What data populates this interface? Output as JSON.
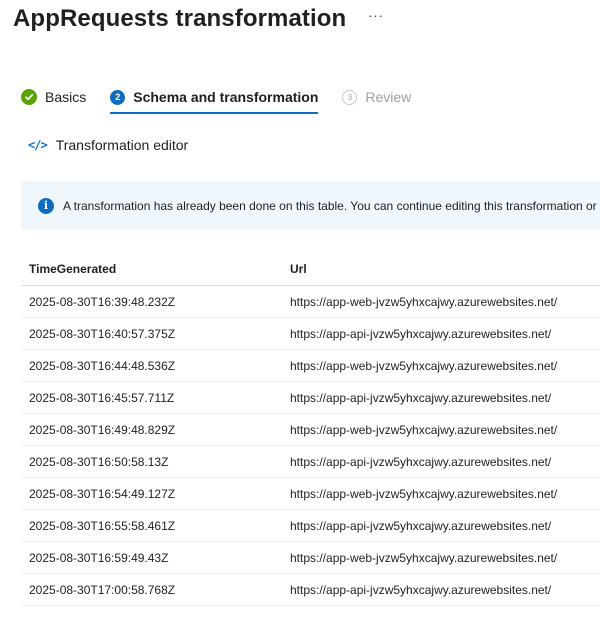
{
  "header": {
    "title": "AppRequests transformation",
    "more_label": "···"
  },
  "steps": [
    {
      "number": "✓",
      "label": "Basics",
      "state": "complete"
    },
    {
      "number": "2",
      "label": "Schema and transformation",
      "state": "active"
    },
    {
      "number": "3",
      "label": "Review",
      "state": "disabled"
    }
  ],
  "toolbar": {
    "editor_icon": "</>",
    "editor_label": "Transformation editor"
  },
  "banner": {
    "icon": "i",
    "message": "A transformation has already been done on this table. You can continue editing this transformation or"
  },
  "table": {
    "columns": [
      "TimeGenerated",
      "Url"
    ],
    "rows": [
      [
        "2025-08-30T16:39:48.232Z",
        "https://app-web-jvzw5yhxcajwy.azurewebsites.net/"
      ],
      [
        "2025-08-30T16:40:57.375Z",
        "https://app-api-jvzw5yhxcajwy.azurewebsites.net/"
      ],
      [
        "2025-08-30T16:44:48.536Z",
        "https://app-web-jvzw5yhxcajwy.azurewebsites.net/"
      ],
      [
        "2025-08-30T16:45:57.711Z",
        "https://app-api-jvzw5yhxcajwy.azurewebsites.net/"
      ],
      [
        "2025-08-30T16:49:48.829Z",
        "https://app-web-jvzw5yhxcajwy.azurewebsites.net/"
      ],
      [
        "2025-08-30T16:50:58.13Z",
        "https://app-api-jvzw5yhxcajwy.azurewebsites.net/"
      ],
      [
        "2025-08-30T16:54:49.127Z",
        "https://app-web-jvzw5yhxcajwy.azurewebsites.net/"
      ],
      [
        "2025-08-30T16:55:58.461Z",
        "https://app-api-jvzw5yhxcajwy.azurewebsites.net/"
      ],
      [
        "2025-08-30T16:59:49.43Z",
        "https://app-web-jvzw5yhxcajwy.azurewebsites.net/"
      ],
      [
        "2025-08-30T17:00:58.768Z",
        "https://app-api-jvzw5yhxcajwy.azurewebsites.net/"
      ]
    ]
  },
  "colors": {
    "accent": "#0f6cbd",
    "success": "#57a300",
    "banner_bg": "#eff6fc"
  }
}
